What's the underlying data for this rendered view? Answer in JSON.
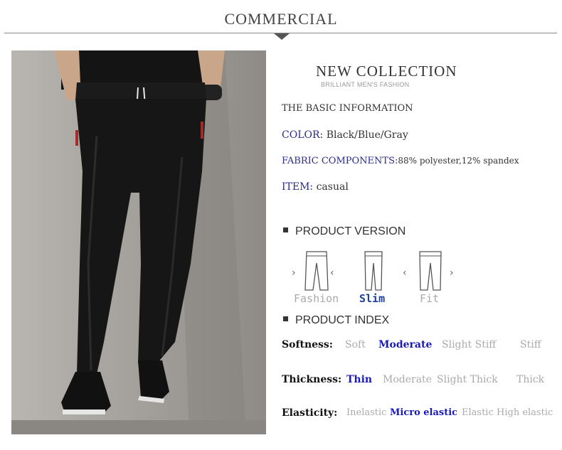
{
  "header": {
    "title": "COMMERCIAL"
  },
  "collection": {
    "title": "NEW COLLECTION",
    "subtitle": "BRILLIANT MEN'S FASHION"
  },
  "basic_info": {
    "heading": "THE BASIC INFORMATION",
    "color_label": "COLOR:",
    "color_value": "Black/Blue/Gray",
    "fabric_label": "FABRIC COMPONENTS:",
    "fabric_value": "88% polyester,12% spandex",
    "item_label": "ITEM:",
    "item_value": "casual"
  },
  "product_version": {
    "heading": "PRODUCT VERSION",
    "options": [
      {
        "label": "Fashion",
        "selected": false
      },
      {
        "label": "Slim",
        "selected": true
      },
      {
        "label": "Fit",
        "selected": false
      }
    ]
  },
  "product_index": {
    "heading": "PRODUCT INDEX",
    "rows": [
      {
        "label": "Softness:",
        "options": [
          "Soft",
          "Moderate",
          "Slight Stiff",
          "Stiff"
        ],
        "selected": 1
      },
      {
        "label": "Thickness:",
        "options": [
          "Thin",
          "Moderate",
          "Slight Thick",
          "Thick"
        ],
        "selected": 0
      },
      {
        "label": "Elasticity:",
        "options": [
          "Inelastic",
          "Micro elastic",
          "Elastic",
          "High elastic"
        ],
        "selected": 1
      }
    ]
  },
  "colors": {
    "accent_blue": "#1a1ab8",
    "label_blue": "#2b2b8a",
    "muted": "#aaaaaa"
  }
}
